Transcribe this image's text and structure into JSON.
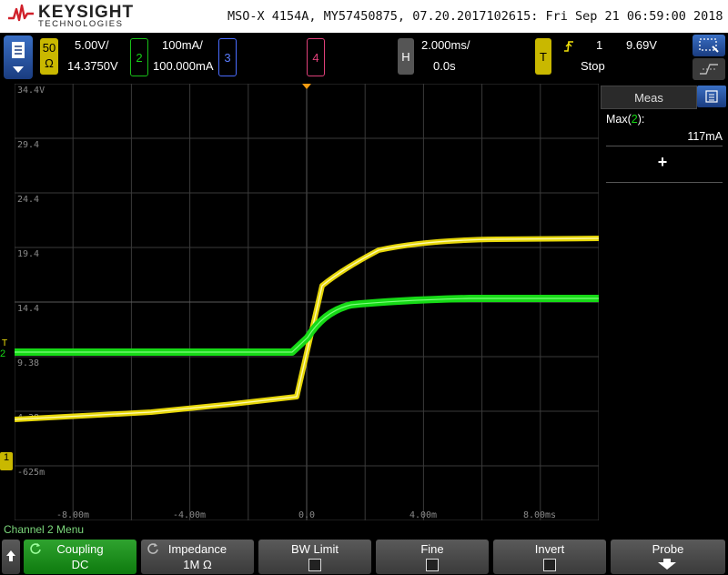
{
  "header": {
    "brand": "KEYSIGHT",
    "brand_sub": "TECHNOLOGIES",
    "device_info": "MSO-X 4154A, MY57450875, 07.20.2017102615: Fri Sep 21 06:59:00 2018"
  },
  "status": {
    "ch1": {
      "number": "1",
      "badge_top": "50",
      "badge_bottom": "Ω",
      "scale": "5.00V/",
      "offset": "14.3750V"
    },
    "ch2": {
      "number": "2",
      "scale": "100mA/",
      "offset": "100.000mA"
    },
    "ch3": {
      "number": "3"
    },
    "ch4": {
      "number": "4"
    },
    "horizontal": {
      "letter": "H",
      "timebase": "2.000ms/",
      "delay": "0.0s"
    },
    "trigger": {
      "letter": "T",
      "source": "1",
      "level": "9.69V",
      "state": "Stop"
    }
  },
  "grid": {
    "y_labels": [
      "34.4V",
      "29.4",
      "24.4",
      "19.4",
      "14.4",
      "9.38",
      "4.38",
      "-625m"
    ],
    "x_labels": [
      "-8.00m",
      "-4.00m",
      "0.0",
      "4.00m",
      "8.00ms"
    ],
    "ground_markers": {
      "ch1": "1",
      "ch2": "2",
      "trigger": "T"
    }
  },
  "panel": {
    "title": "Meas",
    "measurement_label": "Max",
    "measurement_channel": "2",
    "measurement_value": "117mA",
    "add_symbol": "+"
  },
  "menu": {
    "title": "Channel 2 Menu",
    "softkeys": [
      {
        "label": "Coupling",
        "value": "DC"
      },
      {
        "label": "Impedance",
        "value": "1M Ω"
      },
      {
        "label": "BW Limit",
        "value": ""
      },
      {
        "label": "Fine",
        "value": ""
      },
      {
        "label": "Invert",
        "value": ""
      },
      {
        "label": "Probe",
        "value": ""
      }
    ]
  },
  "colors": {
    "ch1": "#f2e20a",
    "ch2": "#16d916",
    "ch3": "#4a6cff",
    "ch4": "#e0407a",
    "grid": "#3a3a3a",
    "grid_label": "#8a8a8a",
    "trigger_marker": "#f39c12"
  },
  "icons": [
    "keysight-logo-icon",
    "menu-down-icon",
    "rotate-knob-icon",
    "trigger-edge-icon",
    "zoom-select-icon",
    "dock-panel-icon",
    "probe-down-arrow-icon",
    "up-arrow-icon"
  ]
}
